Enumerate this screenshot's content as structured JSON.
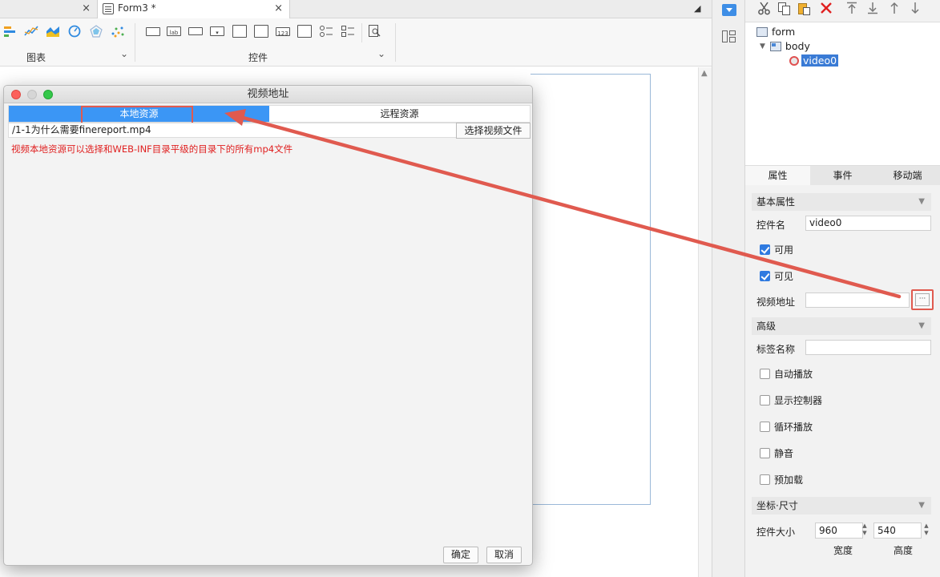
{
  "tabs": {
    "active_label": "Form3 *",
    "close_glyph": "×"
  },
  "toolbar": {
    "chart_group_label": "图表",
    "widget_group_label": "控件",
    "chevron": "⌄",
    "ctl_lab": "lab",
    "ctl_num": "123"
  },
  "tree": {
    "form": "form",
    "body": "body",
    "video": "video0"
  },
  "panel_tabs": [
    "属性",
    "事件",
    "移动端"
  ],
  "props": {
    "basic_header": "基本属性",
    "name_label": "控件名",
    "name_value": "video0",
    "enabled_label": "可用",
    "visible_label": "可见",
    "video_url_label": "视频地址",
    "video_url_button": "···",
    "advanced_header": "高级",
    "tag_label": "标签名称",
    "autoplay_label": "自动播放",
    "show_controls_label": "显示控制器",
    "loop_label": "循环播放",
    "mute_label": "静音",
    "preload_label": "预加载",
    "coords_header": "坐标·尺寸",
    "size_label": "控件大小",
    "width_value": "960",
    "height_value": "540",
    "width_caption": "宽度",
    "height_caption": "高度"
  },
  "dialog": {
    "title": "视频地址",
    "tab_local": "本地资源",
    "tab_remote": "远程资源",
    "path_value": "/1-1为什么需要finereport.mp4",
    "pick_button": "选择视频文件",
    "hint": "视频本地资源可以选择和WEB-INF目录平级的目录下的所有mp4文件",
    "ok": "确定",
    "cancel": "取消"
  },
  "colors": {
    "accent_blue": "#3b96f5",
    "annotation_red": "#e05a4f",
    "hint_red": "#e02020"
  }
}
